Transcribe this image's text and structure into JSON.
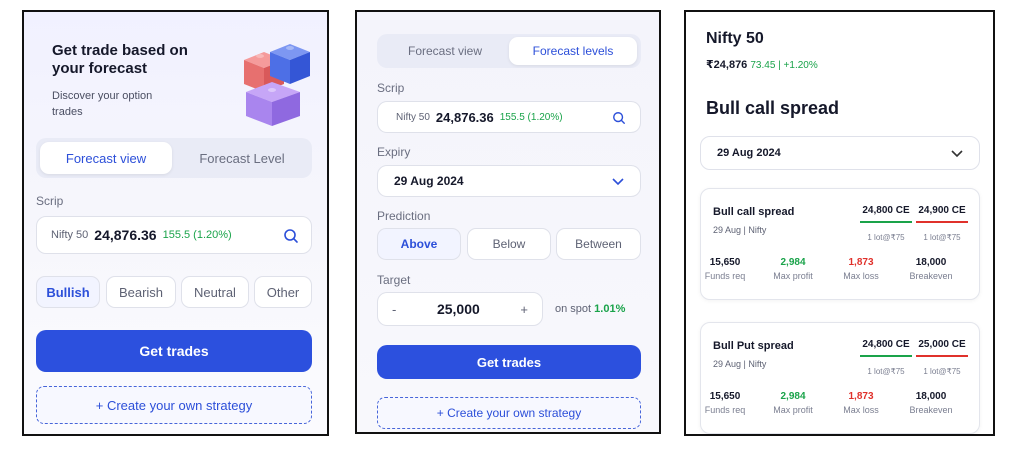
{
  "colors": {
    "primary": "#2c50de",
    "green": "#1aa34a",
    "red": "#e0312b"
  },
  "panel1": {
    "hero_title": "Get trade based on your forecast",
    "hero_subtitle": "Discover your option trades",
    "tabs": [
      {
        "label": "Forecast view",
        "active": true
      },
      {
        "label": "Forecast Level",
        "active": false
      }
    ],
    "scrip_label": "Scrip",
    "scrip": {
      "name": "Nifty 50",
      "price": "24,876.36",
      "change": "155.5 (1.20%)"
    },
    "sentiments": [
      {
        "label": "Bullish",
        "active": true
      },
      {
        "label": "Bearish",
        "active": false
      },
      {
        "label": "Neutral",
        "active": false
      },
      {
        "label": "Other",
        "active": false
      }
    ],
    "get_trades": "Get trades",
    "create_strategy": "+ Create your own strategy"
  },
  "panel2": {
    "tabs": [
      {
        "label": "Forecast view",
        "active": false
      },
      {
        "label": "Forecast levels",
        "active": true
      }
    ],
    "scrip_label": "Scrip",
    "scrip": {
      "name": "Nifty 50",
      "price": "24,876.36",
      "change": "155.5 (1.20%)"
    },
    "expiry_label": "Expiry",
    "expiry_value": "29 Aug 2024",
    "prediction_label": "Prediction",
    "predictions": [
      {
        "label": "Above",
        "active": true
      },
      {
        "label": "Below",
        "active": false
      },
      {
        "label": "Between",
        "active": false
      }
    ],
    "target_label": "Target",
    "target": {
      "minus": "-",
      "value": "25,000",
      "plus": "+"
    },
    "on_spot_label": "on spot",
    "on_spot_value": "1.01%",
    "get_trades": "Get trades",
    "create_strategy": "+ Create your own strategy"
  },
  "panel3": {
    "title": "Nifty 50",
    "price": "₹24,876",
    "change": "73.45 | +1.20%",
    "strategy_title": "Bull call spread",
    "expiry_value": "29 Aug 2024",
    "cards": [
      {
        "title": "Bull call spread",
        "subtitle": "29 Aug | Nifty",
        "legs": [
          {
            "strike": "24,800 CE",
            "lot": "1 lot@₹75",
            "side": "buy"
          },
          {
            "strike": "24,900 CE",
            "lot": "1 lot@₹75",
            "side": "sell"
          }
        ],
        "stats": [
          {
            "value": "15,650",
            "label": "Funds req",
            "tone": "neutral"
          },
          {
            "value": "2,984",
            "label": "Max profit",
            "tone": "green"
          },
          {
            "value": "1,873",
            "label": "Max loss",
            "tone": "red"
          },
          {
            "value": "18,000",
            "label": "Breakeven",
            "tone": "neutral"
          }
        ]
      },
      {
        "title": "Bull Put spread",
        "subtitle": "29 Aug | Nifty",
        "legs": [
          {
            "strike": "24,800 CE",
            "lot": "1 lot@₹75",
            "side": "buy"
          },
          {
            "strike": "25,000 CE",
            "lot": "1 lot@₹75",
            "side": "sell"
          }
        ],
        "stats": [
          {
            "value": "15,650",
            "label": "Funds req",
            "tone": "neutral"
          },
          {
            "value": "2,984",
            "label": "Max profit",
            "tone": "green"
          },
          {
            "value": "1,873",
            "label": "Max loss",
            "tone": "red"
          },
          {
            "value": "18,000",
            "label": "Breakeven",
            "tone": "neutral"
          }
        ]
      }
    ]
  }
}
